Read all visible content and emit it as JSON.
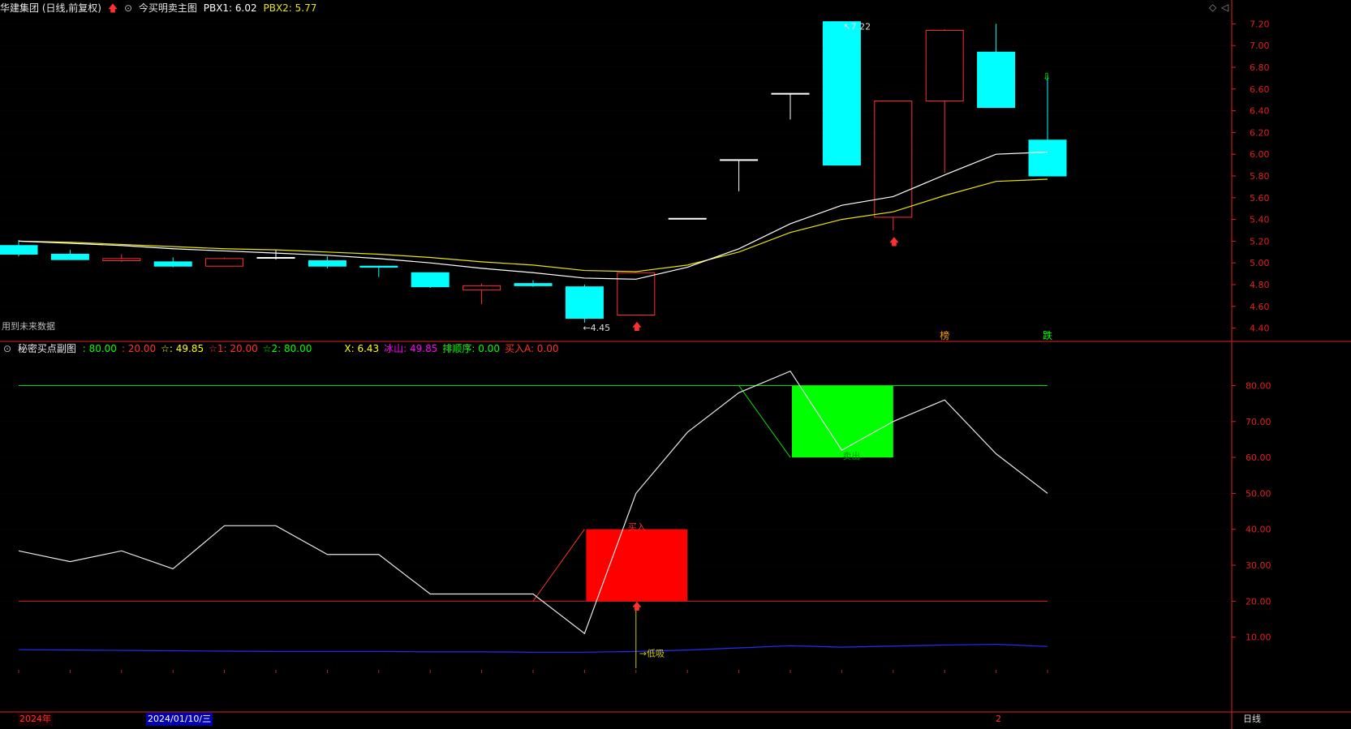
{
  "header": {
    "stock_name": "华建集团 (日线,前复权)",
    "indicator_name": "今买明卖主图",
    "pbx1_label": "PBX1: 6.02",
    "pbx2_label": "PBX2: 5.77",
    "future_note": "用到未来数据"
  },
  "sub_header": {
    "title": "秘密买点副图",
    "items": [
      {
        "text": ": 80.00",
        "color": "#00ff00"
      },
      {
        "text": ": 20.00",
        "color": "#ff3030"
      },
      {
        "text": "☆: 49.85",
        "color": "#ffff00"
      },
      {
        "text": "☆1: 20.00",
        "color": "#ff3030"
      },
      {
        "text": "☆2: 80.00",
        "color": "#00ff00"
      },
      {
        "text": "X: 6.43",
        "color": "#ffff00"
      },
      {
        "text": "冰山: 49.85",
        "color": "#ff00ff"
      },
      {
        "text": "排顺序: 0.00",
        "color": "#00ff00"
      },
      {
        "text": "买入A: 0.00",
        "color": "#ff3030"
      }
    ]
  },
  "bottom_bar": {
    "year_label": "2024年",
    "date_label": "2024/01/10/三",
    "month_label": "2",
    "period_label": "日线"
  },
  "colors": {
    "up": "#ff3030",
    "down": "#00ffff",
    "ma1": "#ffffff",
    "ma2": "#e8e800",
    "axis": "#e02020",
    "buy_box": "#ff0000",
    "sell_box": "#00ff00"
  },
  "chart_data": [
    {
      "type": "candlestick",
      "ylim": [
        4.3,
        7.3
      ],
      "y_ticks": [
        "4.40",
        "4.60",
        "4.80",
        "5.00",
        "5.20",
        "5.40",
        "5.60",
        "5.80",
        "6.00",
        "6.20",
        "6.40",
        "6.60",
        "6.80",
        "7.00",
        "7.20"
      ],
      "candles": [
        {
          "o": 5.16,
          "h": 5.21,
          "c": 5.08,
          "l": 5.06
        },
        {
          "o": 5.08,
          "h": 5.12,
          "c": 5.03,
          "l": 5.03
        },
        {
          "o": 5.02,
          "h": 5.08,
          "c": 5.04,
          "l": 5.01
        },
        {
          "o": 5.01,
          "h": 5.05,
          "c": 4.97,
          "l": 4.96
        },
        {
          "o": 4.97,
          "h": 5.05,
          "c": 5.04,
          "l": 4.97
        },
        {
          "o": 5.05,
          "h": 5.12,
          "c": 5.05,
          "l": 5.03
        },
        {
          "o": 5.02,
          "h": 5.06,
          "c": 4.97,
          "l": 4.95
        },
        {
          "o": 4.97,
          "h": 4.97,
          "c": 4.96,
          "l": 4.87
        },
        {
          "o": 4.91,
          "h": 4.91,
          "c": 4.78,
          "l": 4.77
        },
        {
          "o": 4.75,
          "h": 4.81,
          "c": 4.79,
          "l": 4.62
        },
        {
          "o": 4.81,
          "h": 4.84,
          "c": 4.79,
          "l": 4.78
        },
        {
          "o": 4.78,
          "h": 4.8,
          "c": 4.49,
          "l": 4.45
        },
        {
          "o": 4.52,
          "h": 4.92,
          "c": 4.91,
          "l": 4.52
        },
        {
          "o": 5.41,
          "h": 5.41,
          "c": 5.41,
          "l": 5.41
        },
        {
          "o": 5.95,
          "h": 5.95,
          "c": 5.95,
          "l": 5.66
        },
        {
          "o": 6.56,
          "h": 6.56,
          "c": 6.56,
          "l": 6.32
        },
        {
          "o": 7.22,
          "h": 7.22,
          "c": 5.9,
          "l": 5.9
        },
        {
          "o": 5.42,
          "h": 6.49,
          "c": 6.49,
          "l": 5.3
        },
        {
          "o": 6.49,
          "h": 7.15,
          "c": 7.14,
          "l": 5.83
        },
        {
          "o": 6.94,
          "h": 7.2,
          "c": 6.43,
          "l": 6.43
        },
        {
          "o": 6.13,
          "h": 6.73,
          "c": 5.8,
          "l": 5.8
        }
      ],
      "ma1": [
        5.2,
        5.18,
        5.16,
        5.13,
        5.11,
        5.09,
        5.07,
        5.04,
        5.0,
        4.95,
        4.91,
        4.86,
        4.85,
        4.96,
        5.13,
        5.36,
        5.53,
        5.61,
        5.81,
        6.0,
        6.02
      ],
      "ma2": [
        5.2,
        5.19,
        5.17,
        5.15,
        5.13,
        5.12,
        5.1,
        5.08,
        5.05,
        5.01,
        4.98,
        4.93,
        4.92,
        4.98,
        5.1,
        5.28,
        5.4,
        5.47,
        5.62,
        5.75,
        5.77
      ],
      "annotations": {
        "high_label": "7.22",
        "low_label": "4.45",
        "mark_1": "榜",
        "mark_2": "跌"
      },
      "buy_arrow_indices": [
        12,
        17
      ],
      "sell_arrow_indices": [
        20
      ]
    },
    {
      "type": "line",
      "ylim": [
        0,
        88
      ],
      "y_ticks": [
        "10.00",
        "20.00",
        "30.00",
        "40.00",
        "50.00",
        "60.00",
        "70.00",
        "80.00"
      ],
      "line_80": 80,
      "line_20": 20,
      "osc": [
        34,
        31,
        34,
        29,
        41,
        41,
        33,
        33,
        22,
        22,
        22,
        11,
        50,
        67,
        78,
        84,
        62,
        70,
        76,
        61,
        50
      ],
      "blue": [
        6.5,
        6.4,
        6.3,
        6.2,
        6.1,
        6.0,
        6.0,
        6.0,
        5.9,
        5.9,
        5.8,
        5.8,
        6.0,
        6.4,
        7.0,
        7.6,
        7.2,
        7.5,
        7.8,
        8.0,
        7.4
      ],
      "buy_box": {
        "from": 11,
        "to": 13,
        "low": 20,
        "high": 40,
        "label": "买入"
      },
      "sell_box": {
        "from": 15,
        "to": 17,
        "low": 60,
        "high": 80,
        "label": "卖出"
      },
      "signal_label": "低吸"
    }
  ]
}
